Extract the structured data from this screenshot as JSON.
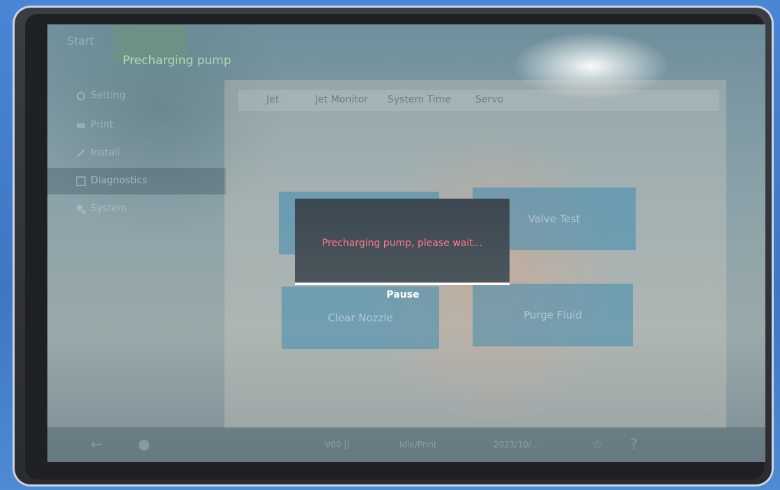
{
  "title_bar": {
    "start_label": "Start",
    "title": "Precharging pump"
  },
  "sidebar": {
    "items": [
      {
        "label": "Setting",
        "icon": "settings-icon"
      },
      {
        "label": "Print",
        "icon": "print-icon"
      },
      {
        "label": "Install",
        "icon": "install-icon"
      },
      {
        "label": "Diagnostics",
        "icon": "diagnostics-icon",
        "active": true
      },
      {
        "label": "System",
        "icon": "system-icon"
      }
    ]
  },
  "tabs": [
    "Jet",
    "Jet Monitor",
    "System Time",
    "Servo"
  ],
  "tiles": {
    "top_left": "",
    "valve_test": "Valve Test",
    "clear_nozzle": "Clear Nozzle",
    "bottom_right": "Purge Fluid"
  },
  "modal": {
    "message": "Precharging pump, please wait...",
    "button_label": "Pause"
  },
  "bottom_bar": {
    "back_icon": "back-arrow-icon",
    "user_icon": "user-icon",
    "item1": "V00 ||",
    "item2": "Idle/Print",
    "item3": "2023/10/...",
    "star_icon": "star-icon",
    "help_icon": "help-icon"
  },
  "colors": {
    "modal_message": "#ff7a86",
    "modal_bg": "#3c4750",
    "frame": "#3e77c2"
  }
}
